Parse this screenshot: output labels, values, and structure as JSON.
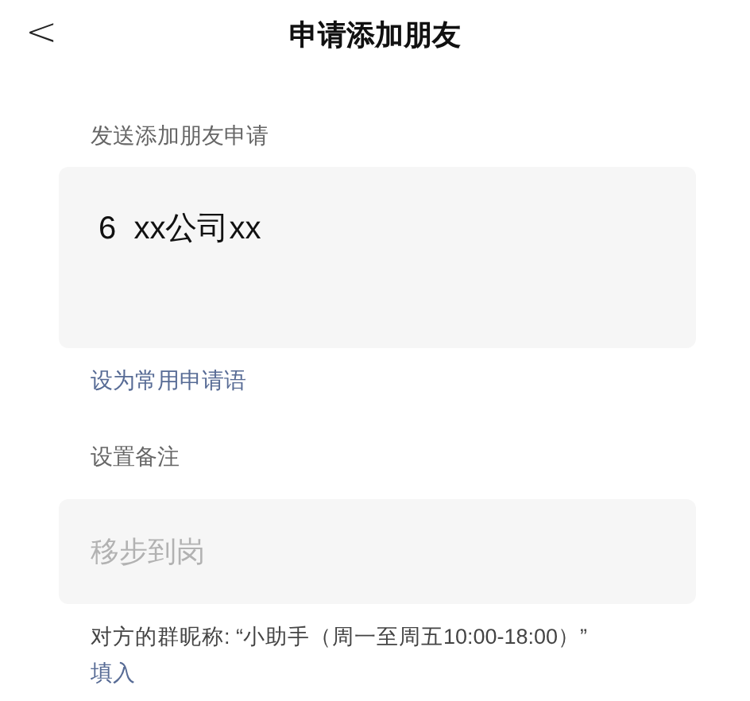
{
  "header": {
    "back": "<",
    "title": "申请添加朋友"
  },
  "request": {
    "label": "发送添加朋友申请",
    "value": "6  xx公司xx",
    "link": "设为常用申请语"
  },
  "remark": {
    "label": "设置备注",
    "placeholder": "移步到岗",
    "hint": "对方的群昵称: “小助手（周一至周五10:00-18:00）”",
    "link": "填入"
  }
}
